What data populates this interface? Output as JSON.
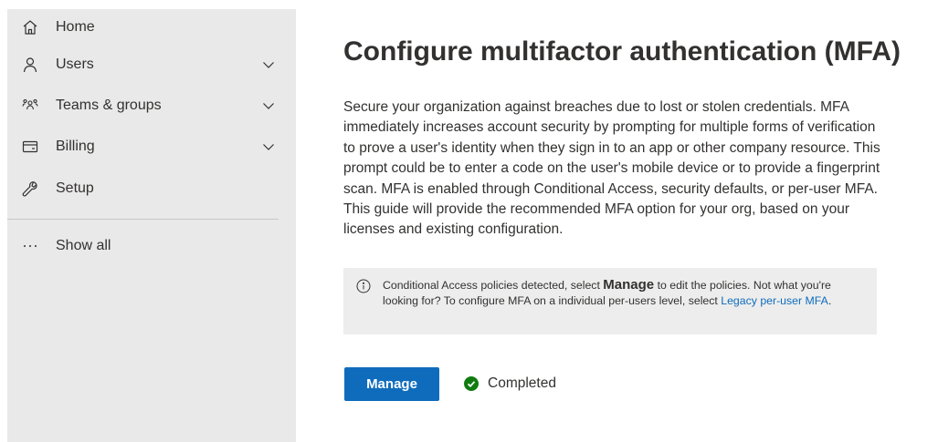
{
  "sidebar": {
    "items": [
      {
        "label": "Home",
        "icon": "home-icon"
      },
      {
        "label": "Users",
        "icon": "person-icon",
        "expandable": true
      },
      {
        "label": "Teams & groups",
        "icon": "people-team-icon",
        "expandable": true
      },
      {
        "label": "Billing",
        "icon": "credit-card-icon",
        "expandable": true
      },
      {
        "label": "Setup",
        "icon": "wrench-icon"
      }
    ],
    "show_all": {
      "label": "Show all",
      "icon": "more-horizontal-icon"
    }
  },
  "main": {
    "title": "Configure multifactor authentication (MFA)",
    "description": "Secure your organization against breaches due to lost or stolen credentials. MFA immediately increases account security by prompting for multiple forms of verification to prove a user's identity when they sign in to an app or other company resource. This prompt could be to enter a code on the user's mobile device or to provide a fingerprint scan. MFA is enabled through Conditional Access, security defaults, or per-user MFA. This guide will provide the recommended MFA option for your org, based on your licenses and existing configuration.",
    "info": {
      "text_before": "Conditional Access policies detected, select ",
      "bold": "Manage",
      "text_after": " to edit the policies. Not what you're looking for? To configure MFA on a individual per-users level, select ",
      "link": "Legacy per-user MFA",
      "text_end": "."
    },
    "manage_button": "Manage",
    "status": "Completed"
  },
  "colors": {
    "sidebar_bg": "#e9e9e9",
    "accent": "#0f6cbd",
    "success": "#107c10",
    "info_bg": "#ededed"
  }
}
